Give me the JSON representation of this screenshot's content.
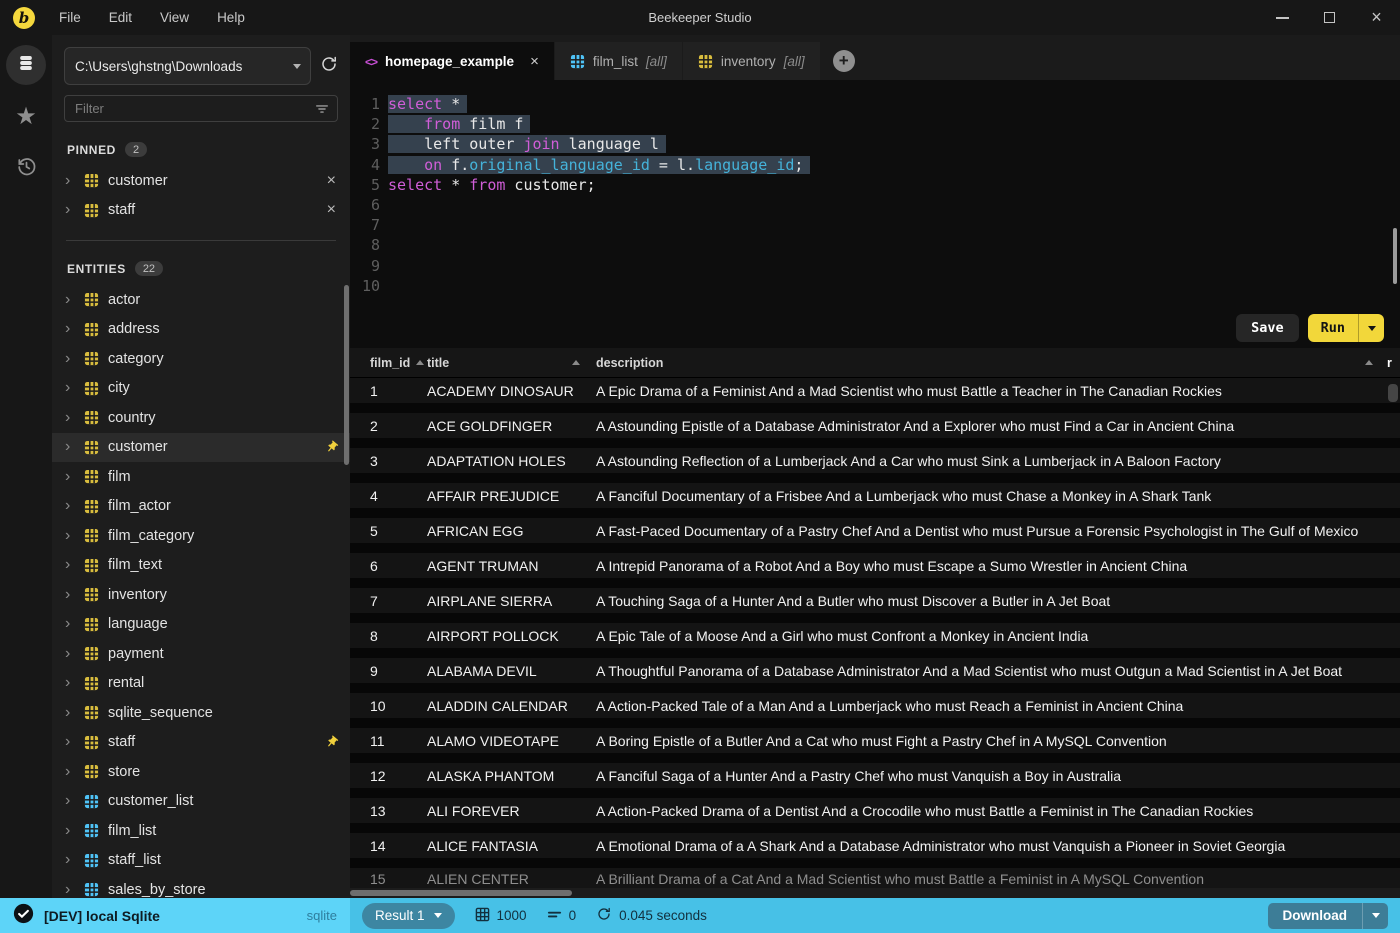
{
  "titlebar": {
    "menus": [
      "File",
      "Edit",
      "View",
      "Help"
    ],
    "title": "Beekeeper Studio"
  },
  "sidebar": {
    "connection_path": "C:\\Users\\ghstng\\Downloads",
    "filter_placeholder": "Filter",
    "pinned": {
      "label": "PINNED",
      "count": "2",
      "items": [
        {
          "name": "customer",
          "type": "table"
        },
        {
          "name": "staff",
          "type": "table"
        }
      ]
    },
    "entities": {
      "label": "ENTITIES",
      "count": "22",
      "items": [
        {
          "name": "actor",
          "type": "table"
        },
        {
          "name": "address",
          "type": "table"
        },
        {
          "name": "category",
          "type": "table"
        },
        {
          "name": "city",
          "type": "table"
        },
        {
          "name": "country",
          "type": "table"
        },
        {
          "name": "customer",
          "type": "table",
          "selected": true,
          "pinned": true
        },
        {
          "name": "film",
          "type": "table"
        },
        {
          "name": "film_actor",
          "type": "table"
        },
        {
          "name": "film_category",
          "type": "table"
        },
        {
          "name": "film_text",
          "type": "table"
        },
        {
          "name": "inventory",
          "type": "table"
        },
        {
          "name": "language",
          "type": "table"
        },
        {
          "name": "payment",
          "type": "table"
        },
        {
          "name": "rental",
          "type": "table"
        },
        {
          "name": "sqlite_sequence",
          "type": "table"
        },
        {
          "name": "staff",
          "type": "table",
          "pinned": true
        },
        {
          "name": "store",
          "type": "table"
        },
        {
          "name": "customer_list",
          "type": "view"
        },
        {
          "name": "film_list",
          "type": "view"
        },
        {
          "name": "staff_list",
          "type": "view"
        },
        {
          "name": "sales_by_store",
          "type": "view"
        }
      ]
    }
  },
  "tabs": {
    "items": [
      {
        "label": "homepage_example",
        "icon": "code",
        "active": true,
        "closable": true
      },
      {
        "label": "film_list",
        "suffix": "[all]",
        "icon": "view",
        "active": false
      },
      {
        "label": "inventory",
        "suffix": "[all]",
        "icon": "table",
        "active": false
      }
    ]
  },
  "editor": {
    "line_count": 10,
    "lines": [
      {
        "selected": true,
        "tokens": [
          [
            "kw",
            "select"
          ],
          [
            "pl",
            " *"
          ]
        ]
      },
      {
        "selected": true,
        "tokens": [
          [
            "pl",
            "    "
          ],
          [
            "kw",
            "from"
          ],
          [
            "pl",
            " film f"
          ]
        ]
      },
      {
        "selected": true,
        "tokens": [
          [
            "pl",
            "    left outer "
          ],
          [
            "kw",
            "join"
          ],
          [
            "pl",
            " language l"
          ]
        ]
      },
      {
        "selected": true,
        "tokens": [
          [
            "pl",
            "    "
          ],
          [
            "kw",
            "on"
          ],
          [
            "pl",
            " f."
          ],
          [
            "fd",
            "original_language_id"
          ],
          [
            "pl",
            " = l."
          ],
          [
            "fd",
            "language_id"
          ],
          [
            "pl",
            ";"
          ]
        ]
      },
      {
        "selected": false,
        "tokens": [
          [
            "kw",
            "select"
          ],
          [
            "pl",
            " * "
          ],
          [
            "kw",
            "from"
          ],
          [
            "pl",
            " customer;"
          ]
        ]
      }
    ]
  },
  "actions": {
    "save": "Save",
    "run": "Run"
  },
  "results": {
    "columns": [
      "film_id",
      "title",
      "description"
    ],
    "partial_next_column": "r",
    "rows": [
      [
        "1",
        "ACADEMY DINOSAUR",
        "A Epic Drama of a Feminist And a Mad Scientist who must Battle a Teacher in The Canadian Rockies"
      ],
      [
        "2",
        "ACE GOLDFINGER",
        "A Astounding Epistle of a Database Administrator And a Explorer who must Find a Car in Ancient China"
      ],
      [
        "3",
        "ADAPTATION HOLES",
        "A Astounding Reflection of a Lumberjack And a Car who must Sink a Lumberjack in A Baloon Factory"
      ],
      [
        "4",
        "AFFAIR PREJUDICE",
        "A Fanciful Documentary of a Frisbee And a Lumberjack who must Chase a Monkey in A Shark Tank"
      ],
      [
        "5",
        "AFRICAN EGG",
        "A Fast-Paced Documentary of a Pastry Chef And a Dentist who must Pursue a Forensic Psychologist in The Gulf of Mexico"
      ],
      [
        "6",
        "AGENT TRUMAN",
        "A Intrepid Panorama of a Robot And a Boy who must Escape a Sumo Wrestler in Ancient China"
      ],
      [
        "7",
        "AIRPLANE SIERRA",
        "A Touching Saga of a Hunter And a Butler who must Discover a Butler in A Jet Boat"
      ],
      [
        "8",
        "AIRPORT POLLOCK",
        "A Epic Tale of a Moose And a Girl who must Confront a Monkey in Ancient India"
      ],
      [
        "9",
        "ALABAMA DEVIL",
        "A Thoughtful Panorama of a Database Administrator And a Mad Scientist who must Outgun a Mad Scientist in A Jet Boat"
      ],
      [
        "10",
        "ALADDIN CALENDAR",
        "A Action-Packed Tale of a Man And a Lumberjack who must Reach a Feminist in Ancient China"
      ],
      [
        "11",
        "ALAMO VIDEOTAPE",
        "A Boring Epistle of a Butler And a Cat who must Fight a Pastry Chef in A MySQL Convention"
      ],
      [
        "12",
        "ALASKA PHANTOM",
        "A Fanciful Saga of a Hunter And a Pastry Chef who must Vanquish a Boy in Australia"
      ],
      [
        "13",
        "ALI FOREVER",
        "A Action-Packed Drama of a Dentist And a Crocodile who must Battle a Feminist in The Canadian Rockies"
      ],
      [
        "14",
        "ALICE FANTASIA",
        "A Emotional Drama of a A Shark And a Database Administrator who must Vanquish a Pioneer in Soviet Georgia"
      ],
      [
        "15",
        "ALIEN CENTER",
        "A Brilliant Drama of a Cat And a Mad Scientist who must Battle a Feminist in A MySQL Convention"
      ]
    ]
  },
  "statusbar": {
    "connection": "[DEV] local Sqlite",
    "db_type": "sqlite",
    "result_selector": "Result 1",
    "row_count": "1000",
    "affected_rows": "0",
    "elapsed": "0.045 seconds",
    "download": "Download"
  },
  "colors": {
    "accent_yellow": "#f5d83d",
    "run_button_yellow": "#f2d73a",
    "statusbar_blue": "#47c1e7",
    "statusbar_blue_light": "#5dd4f8",
    "table_icon_yellow": "#d9bd3e",
    "view_icon_blue": "#4fc3f7",
    "keyword_pink": "#d05ed8",
    "field_cyan": "#45b3da",
    "selection_slate": "#35414e"
  }
}
